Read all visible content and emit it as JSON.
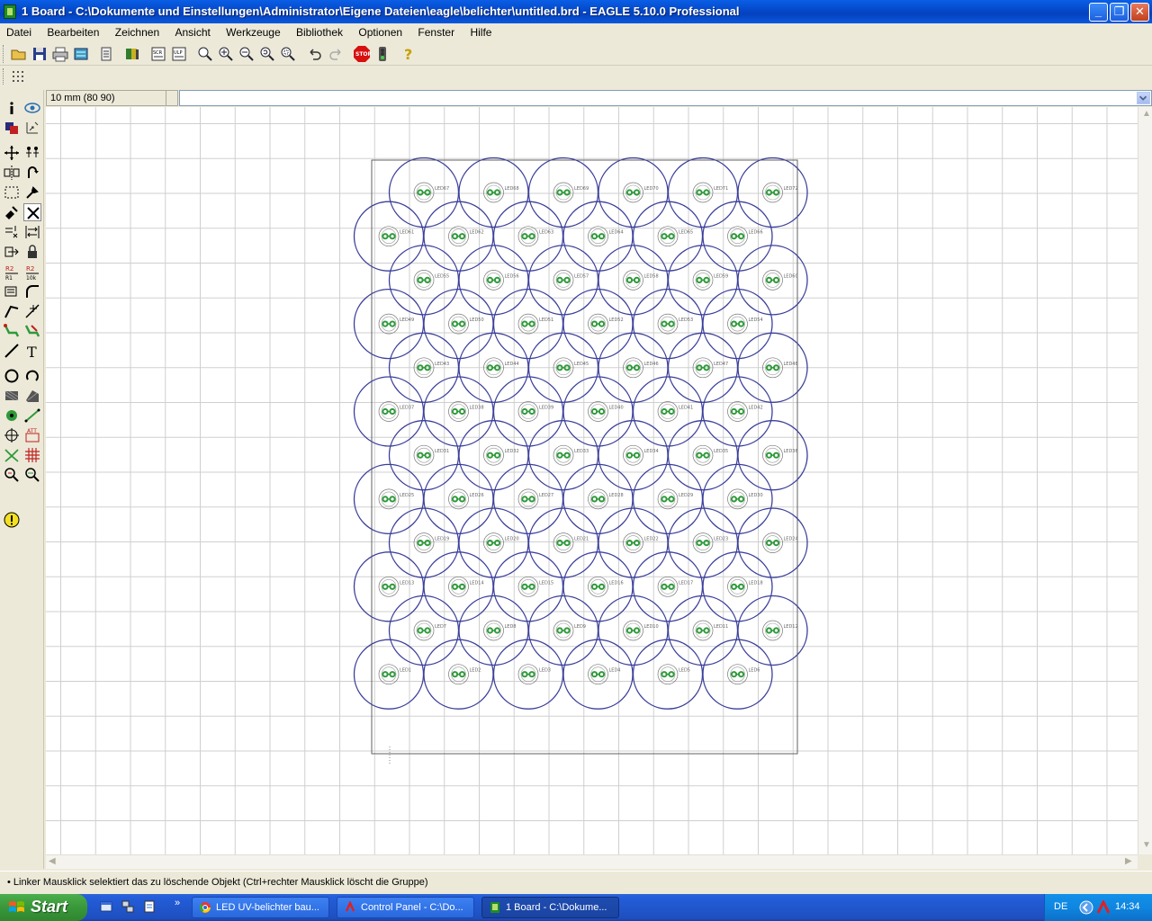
{
  "window": {
    "title": "1 Board - C:\\Dokumente und Einstellungen\\Administrator\\Eigene Dateien\\eagle\\belichter\\untitled.brd - EAGLE 5.10.0 Professional",
    "buttons": [
      "minimize",
      "restore",
      "close"
    ]
  },
  "menu": [
    "Datei",
    "Bearbeiten",
    "Zeichnen",
    "Ansicht",
    "Werkzeuge",
    "Bibliothek",
    "Optionen",
    "Fenster",
    "Hilfe"
  ],
  "toolbar": {
    "items": [
      "open-icon",
      "save-icon",
      "print-icon",
      "cam-icon",
      "board-schematic-switch-icon",
      "library-icon",
      "script-icon",
      "ulp-icon",
      "zoom-fit-icon",
      "zoom-in-icon",
      "zoom-out-icon",
      "zoom-redraw-icon",
      "zoom-select-icon",
      "undo-icon",
      "redo-icon",
      "stop-icon",
      "go-icon",
      "help-icon"
    ]
  },
  "coordinates": "10 mm (80 90)",
  "command_line": "",
  "palette": {
    "items": [
      "info",
      "show",
      "display",
      "mark",
      "move",
      "copy",
      "mirror",
      "rotate",
      "group",
      "change",
      "paste",
      "delete",
      "add",
      "pinswap",
      "replace",
      "lock",
      "name",
      "value",
      "smash",
      "miter",
      "split",
      "optimize",
      "route",
      "ripup",
      "wire",
      "text",
      "circle",
      "arc",
      "rect",
      "polygon",
      "via",
      "signal",
      "hole",
      "attribute",
      "ratsnest",
      "auto",
      "erc",
      "drc",
      "errors"
    ],
    "selected": "delete"
  },
  "board": {
    "leds_per_row": 6,
    "rows": 12,
    "label_prefix": "LED"
  },
  "status": "• Linker Mausklick selektiert das zu löschende Objekt (Ctrl+rechter Mausklick löscht die Gruppe)",
  "taskbar": {
    "start": "Start",
    "tasks": [
      {
        "label": "LED UV-belichter bau...",
        "active": false
      },
      {
        "label": "Control Panel - C:\\Do...",
        "active": false
      },
      {
        "label": "1 Board - C:\\Dokume...",
        "active": true
      }
    ],
    "language": "DE",
    "clock": "14:34"
  },
  "colors": {
    "circle": "#3b3f9a",
    "pad": "#2e9a3a",
    "outline": "#606060",
    "grid": "#cfcfcf"
  }
}
